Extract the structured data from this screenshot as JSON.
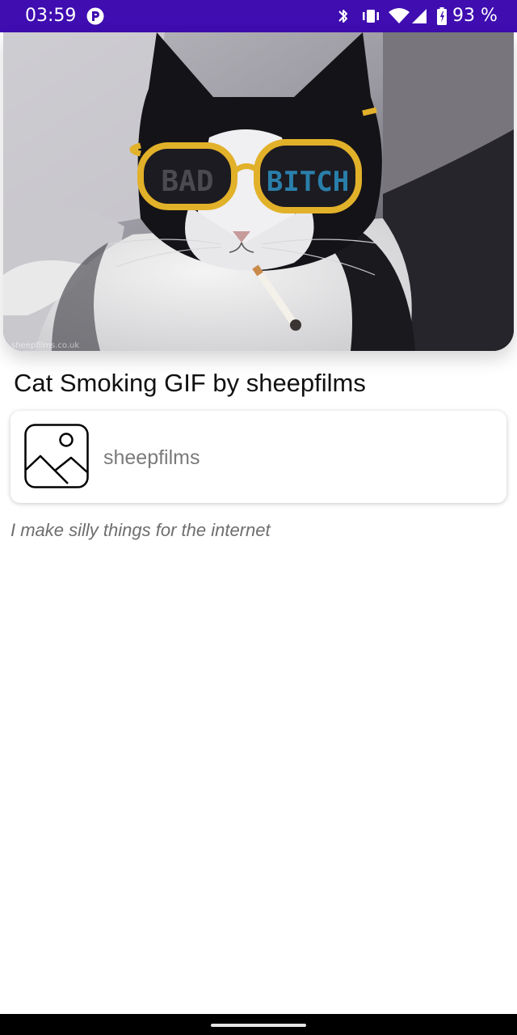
{
  "status_bar": {
    "time": "03:59",
    "battery": "93 %",
    "icons": [
      "app-notification-icon",
      "bluetooth-icon",
      "vibrate-icon",
      "wifi-icon",
      "cell-signal-icon",
      "battery-icon"
    ]
  },
  "gif": {
    "title": "Cat Smoking GIF by sheepfilms",
    "glasses_left_text": "BAD",
    "glasses_right_text": "BITCH",
    "watermark": "sheepfilms.co.uk"
  },
  "user": {
    "username": "sheepfilms",
    "avatar_icon": "image-placeholder-icon",
    "bio": "I make silly things for the internet"
  },
  "colors": {
    "status_bar": "#3f0db0",
    "title_text": "#111111",
    "username_text": "#7a7a7a",
    "bio_text": "#6e6e6e",
    "glasses_frame": "#e2b12a"
  }
}
